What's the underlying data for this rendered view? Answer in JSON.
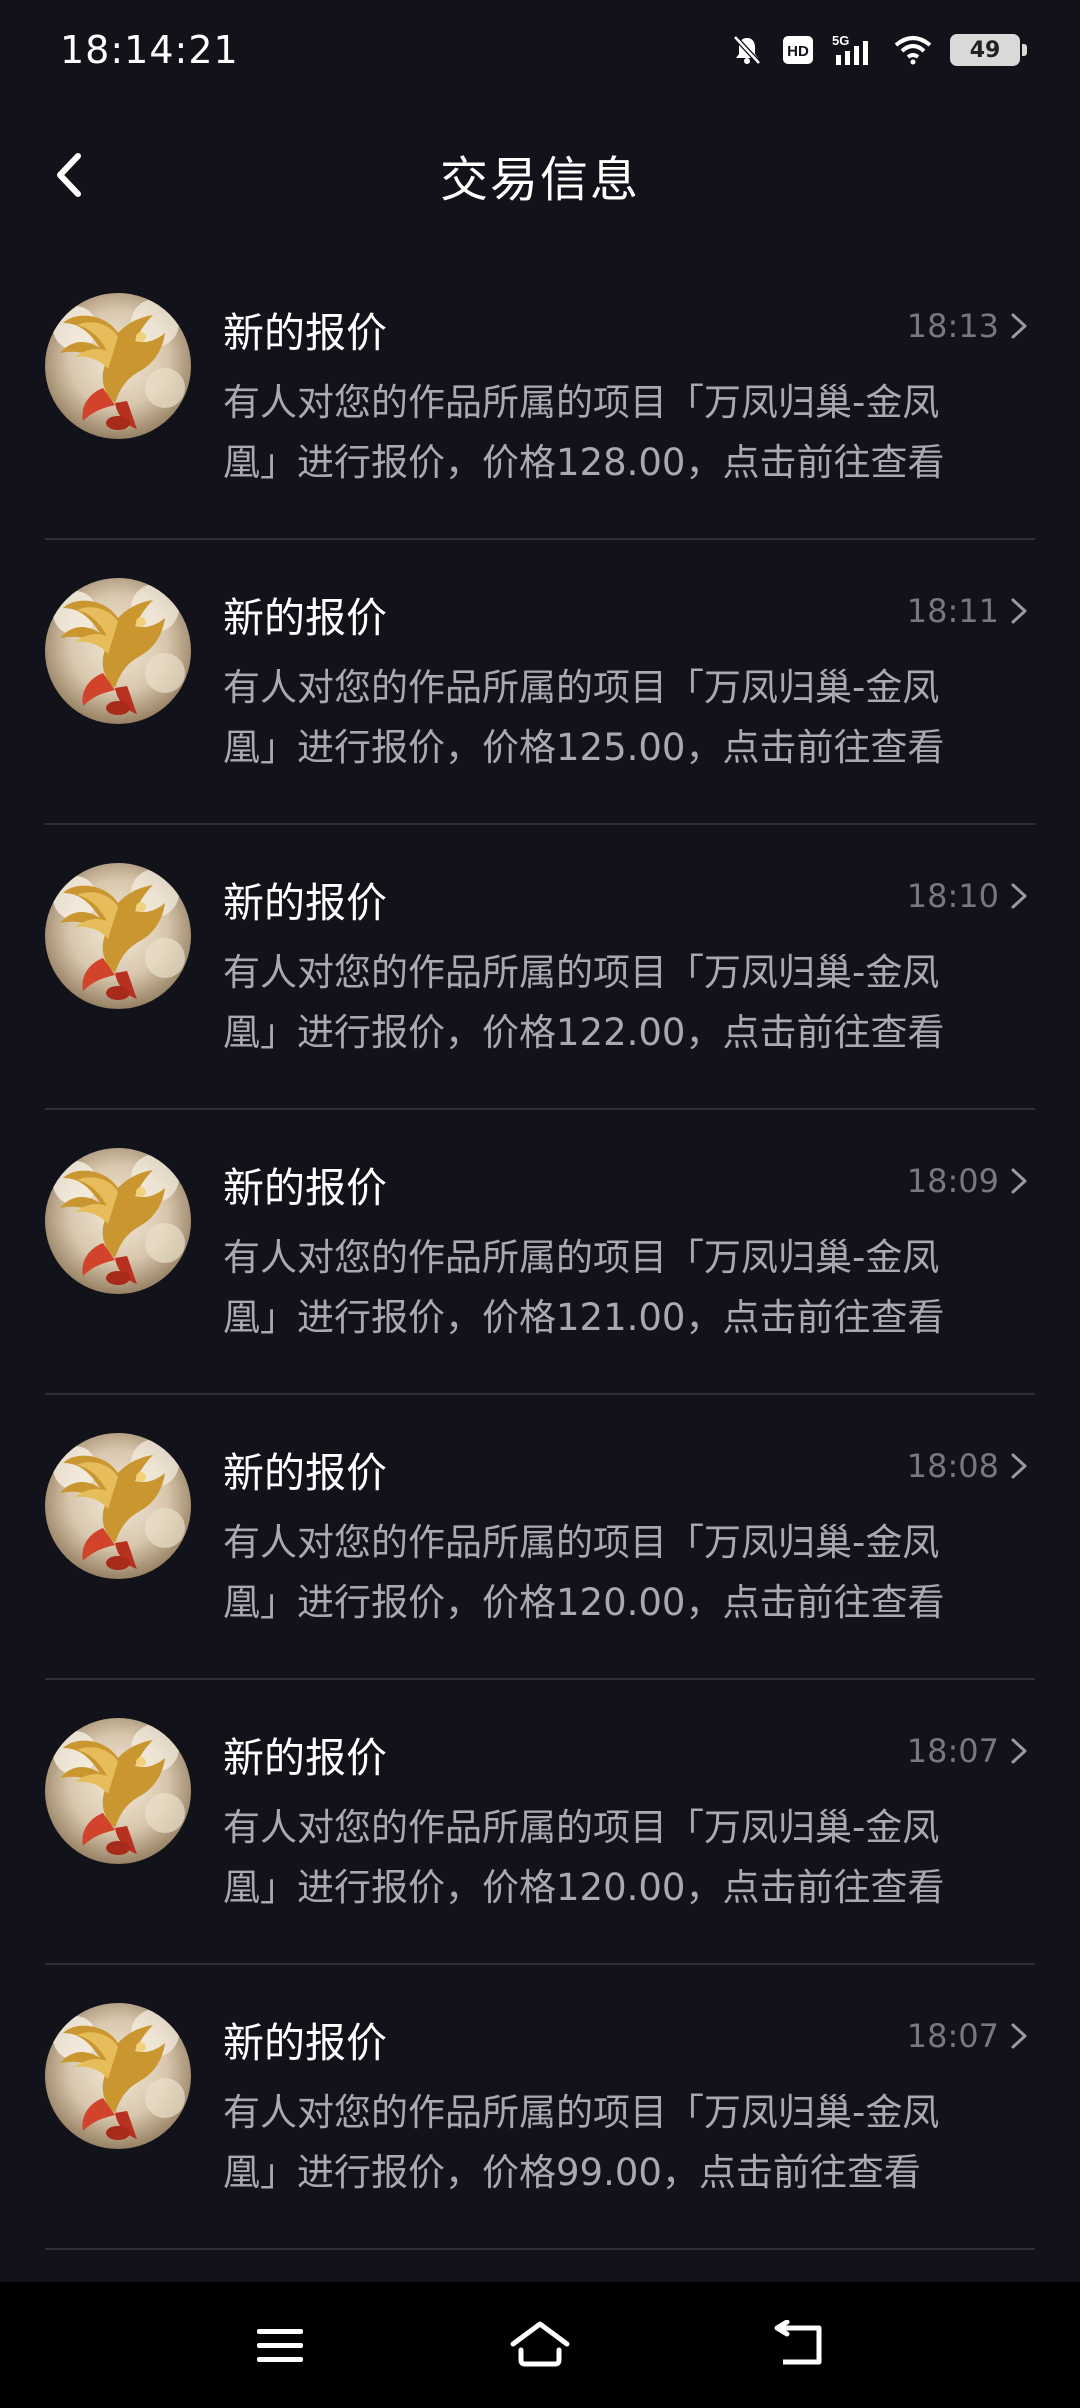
{
  "status_bar": {
    "time": "18:14:21",
    "battery": "49",
    "icons": [
      "mute-icon",
      "hd-icon",
      "5g-signal-icon",
      "wifi-icon",
      "battery-icon"
    ]
  },
  "header": {
    "title": "交易信息",
    "back_icon": "chevron-left-icon"
  },
  "messages": [
    {
      "title": "新的报价",
      "time": "18:13",
      "line1": "有人对您的作品所属的项目「万凤归巢-金凤",
      "line2": "凰」进行报价，价格128.00，点击前往查看"
    },
    {
      "title": "新的报价",
      "time": "18:11",
      "line1": "有人对您的作品所属的项目「万凤归巢-金凤",
      "line2": "凰」进行报价，价格125.00，点击前往查看"
    },
    {
      "title": "新的报价",
      "time": "18:10",
      "line1": "有人对您的作品所属的项目「万凤归巢-金凤",
      "line2": "凰」进行报价，价格122.00，点击前往查看"
    },
    {
      "title": "新的报价",
      "time": "18:09",
      "line1": "有人对您的作品所属的项目「万凤归巢-金凤",
      "line2": "凰」进行报价，价格121.00，点击前往查看"
    },
    {
      "title": "新的报价",
      "time": "18:08",
      "line1": "有人对您的作品所属的项目「万凤归巢-金凤",
      "line2": "凰」进行报价，价格120.00，点击前往查看"
    },
    {
      "title": "新的报价",
      "time": "18:07",
      "line1": "有人对您的作品所属的项目「万凤归巢-金凤",
      "line2": "凰」进行报价，价格120.00，点击前往查看"
    },
    {
      "title": "新的报价",
      "time": "18:07",
      "line1": "有人对您的作品所属的项目「万凤归巢-金凤",
      "line2": "凰」进行报价，价格99.00，点击前往查看"
    }
  ],
  "nav_bar": {
    "icons": [
      "menu-icon",
      "home-icon",
      "back-icon"
    ]
  },
  "colors": {
    "background": "#12121a",
    "title_text": "#ffffff",
    "body_text": "#a9a9b0",
    "time_text": "#77777f",
    "divider": "#2e2e36",
    "nav_background": "#000000"
  }
}
